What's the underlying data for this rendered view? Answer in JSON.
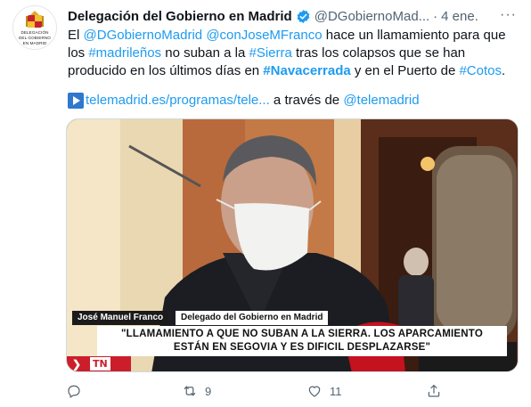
{
  "tweet": {
    "display_name": "Delegación del Gobierno en Madrid",
    "handle": "@DGobiernoMad...",
    "separator": "·",
    "date": "4 ene.",
    "more_label": "···",
    "avatar_text": [
      "DELEGACIÓN",
      "DEL GOBIERNO",
      "EN MADRID"
    ],
    "body": {
      "t1": "El ",
      "mention1": "@DGobiernoMadrid",
      "t2": " ",
      "mention2": "@conJoseMFranco",
      "t3": " hace un llamamiento para que los ",
      "hashtag1": "#madrileños",
      "t4": " no suban a la ",
      "hashtag2": "#Sierra",
      "t5": " tras los colapsos que se han producido en los últimos días en ",
      "hashtag3": "#Navacerrada",
      "t6": " y en el Puerto de ",
      "hashtag4": "#Cotos",
      "t7": "."
    },
    "link": {
      "url_text": "telemadrid.es/programas/tele...",
      "via_text": " a través de ",
      "via_mention": "@telemadrid"
    },
    "video": {
      "caption_name": "José Manuel Franco",
      "caption_role": "Delegado del Gobierno en Madrid",
      "caption_quote_line1": "\"LLAMAMIENTO A QUE NO SUBAN A LA SIERRA. LOS APARCAMIENTO",
      "caption_quote_line2": "ESTÁN EN SEGOVIA Y ES DIFICIL DESPLAZARSE\"",
      "channel_logo": "TN",
      "channel_chevron": "❯"
    },
    "actions": {
      "reply_count": "",
      "retweet_count": "9",
      "like_count": "11",
      "share_count": ""
    },
    "colors": {
      "link": "#1d9bf0",
      "muted": "#536471",
      "verified": "#1d9bf0",
      "telemadrid_red": "#cc1e2a"
    }
  }
}
